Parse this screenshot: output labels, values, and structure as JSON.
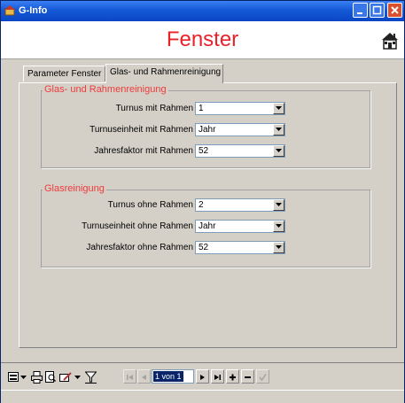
{
  "window": {
    "title": "G-Info"
  },
  "header": {
    "form_title": "Fenster"
  },
  "tabs": [
    {
      "label": "Parameter Fenster"
    },
    {
      "label": "Glas- und Rahmenreinigung"
    }
  ],
  "groups": [
    {
      "legend": "Glas- und Rahmenreinigung",
      "fields": [
        {
          "label": "Turnus mit Rahmen",
          "value": "1"
        },
        {
          "label": "Turnuseinheit mit Rahmen",
          "value": "Jahr"
        },
        {
          "label": "Jahresfaktor mit Rahmen",
          "value": "52"
        }
      ]
    },
    {
      "legend": "Glasreinigung",
      "fields": [
        {
          "label": "Turnus ohne Rahmen",
          "value": "2"
        },
        {
          "label": "Turnuseinheit ohne Rahmen",
          "value": "Jahr"
        },
        {
          "label": "Jahresfaktor ohne Rahmen",
          "value": "52"
        }
      ]
    }
  ],
  "navigation": {
    "record_text": "1 von 1"
  },
  "colors": {
    "title_red": "#e8222a",
    "legend_red": "#f03a3a",
    "titlebar_blue": "#1559d6",
    "selection": "#0a246a"
  }
}
